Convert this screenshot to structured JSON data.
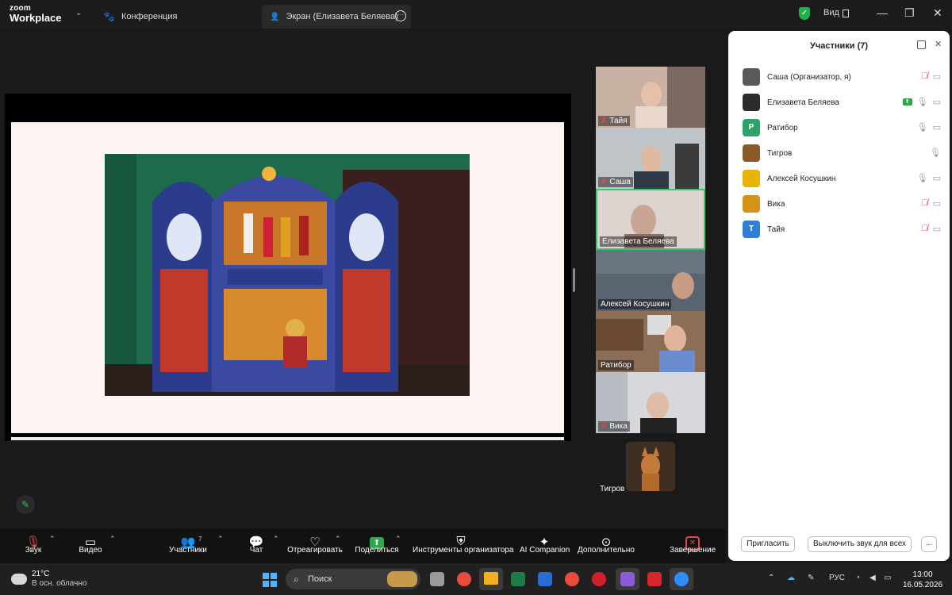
{
  "titlebar": {
    "logo_line1": "zoom",
    "logo_line2": "Workplace",
    "tab_conference": "Конференция",
    "tab_screen": "Экран (Елизавета Беляева)",
    "view_label": "Вид"
  },
  "gallery": [
    {
      "name": "Тайя",
      "muted": true
    },
    {
      "name": "Саша",
      "muted": true
    },
    {
      "name": "Елизавета Беляева",
      "muted": false,
      "active": true
    },
    {
      "name": "Алексей Косушкин",
      "muted": false
    },
    {
      "name": "Ратибор",
      "muted": false
    },
    {
      "name": "Вика",
      "muted": true
    },
    {
      "name": "Тигров",
      "muted": false
    }
  ],
  "panel": {
    "title": "Участники (7)",
    "participants": [
      {
        "name": "Саша (Организатор, я)",
        "avatar": "",
        "color": "#5a5a5a",
        "mic": "muted",
        "video": true
      },
      {
        "name": "Елизавета Беляева",
        "avatar": "",
        "color": "#2b2b2b",
        "mic": "on",
        "video": true,
        "sharing": true
      },
      {
        "name": "Ратибор",
        "avatar": "Р",
        "color": "#2ba36b",
        "mic": "on",
        "video": true
      },
      {
        "name": "Тигров",
        "avatar": "",
        "color": "#8a5a2a",
        "mic": "on",
        "video": false
      },
      {
        "name": "Алексей Косушкин",
        "avatar": "",
        "color": "#e8b400",
        "mic": "on",
        "video": true
      },
      {
        "name": "Вика",
        "avatar": "",
        "color": "#d4931a",
        "mic": "muted",
        "video": true
      },
      {
        "name": "Тайя",
        "avatar": "Т",
        "color": "#2f7fd6",
        "mic": "muted",
        "video": true
      }
    ],
    "invite": "Пригласить",
    "mute_all": "Выключить звук для всех",
    "more": "..."
  },
  "toolbar": {
    "audio": "Звук",
    "video": "Видео",
    "participants": "Участники",
    "participants_count": "7",
    "chat": "Чат",
    "react": "Отреагировать",
    "share": "Поделиться",
    "host_tools": "Инструменты организатора",
    "ai": "AI Companion",
    "more": "Дополнительно",
    "end": "Завершение"
  },
  "taskbar": {
    "temp": "21°C",
    "weather": "В осн. облачно",
    "search": "Поиск",
    "lang": "РУС",
    "time": "13:00",
    "date": "16.05.2026"
  }
}
